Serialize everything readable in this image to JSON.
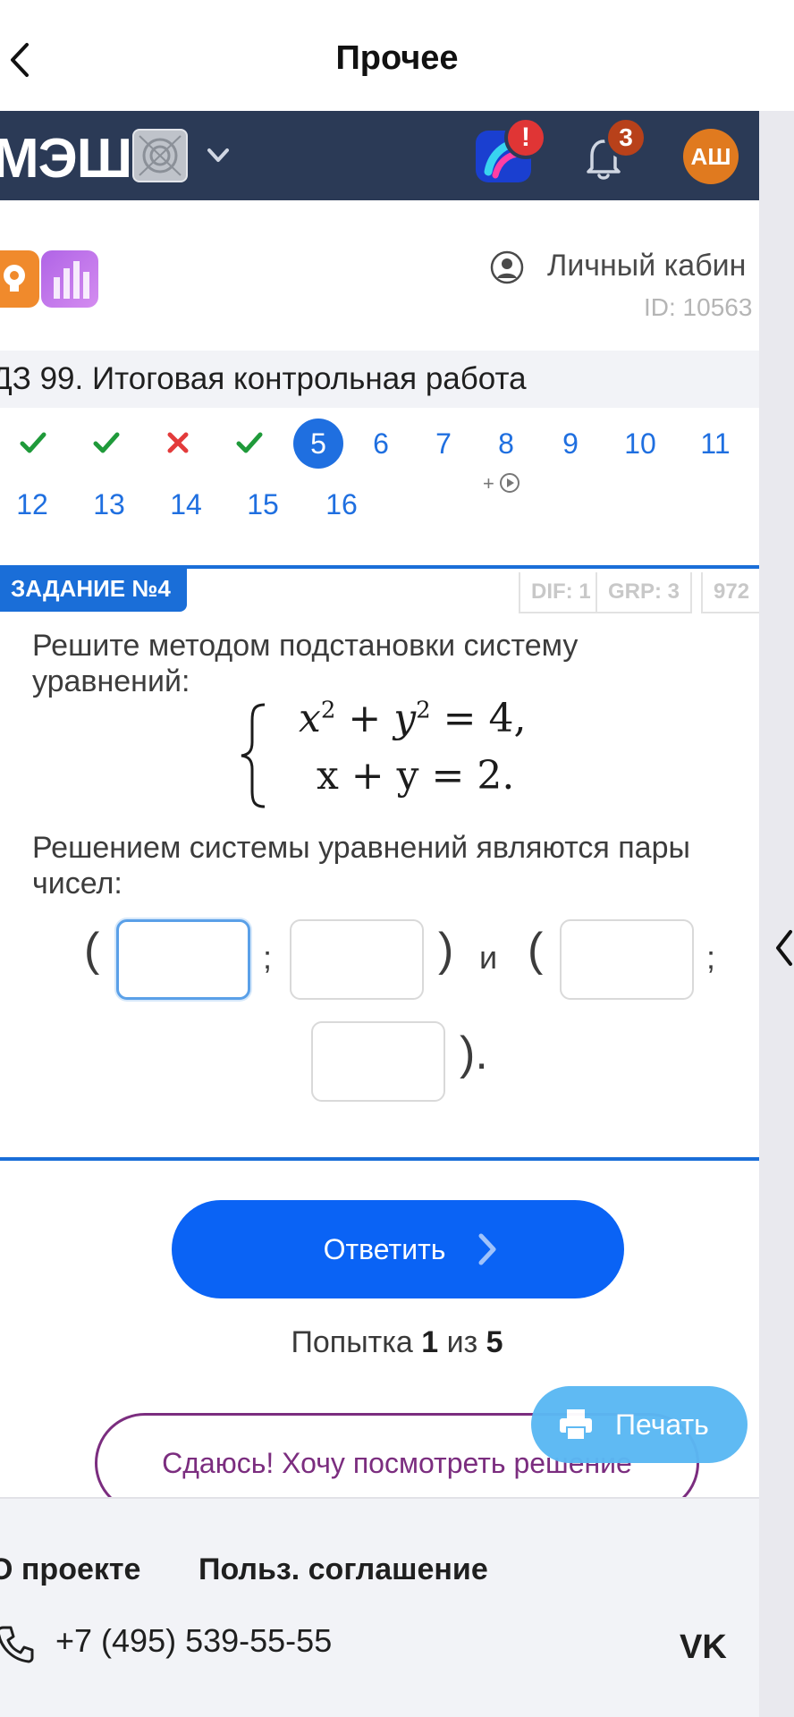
{
  "nav": {
    "title": "Прочее"
  },
  "topbar": {
    "logo": "МЭШ",
    "alert_badge": "!",
    "notifications_count": "3",
    "avatar_initials": "АШ"
  },
  "subheader": {
    "cabinet_label": "Личный кабин",
    "user_id": "ID: 10563"
  },
  "page": {
    "title": "ДЗ 99. Итоговая контрольная работа"
  },
  "task_nav": {
    "statuses": [
      "correct",
      "correct",
      "wrong",
      "correct"
    ],
    "current": "5",
    "numbers_row1": [
      "6",
      "7",
      "8",
      "9",
      "10",
      "11"
    ],
    "numbers_row2": [
      "12",
      "13",
      "14",
      "15",
      "16"
    ],
    "extra_label": "+"
  },
  "task": {
    "tag": "ЗАДАНИЕ №4",
    "meta": [
      "DIF: 1",
      "GRP: 3",
      "972"
    ],
    "prompt": "Решите методом подстановки систему уравнений:",
    "equation_1": {
      "x": "x",
      "y": "y",
      "exp": "2",
      "ops": "+",
      "eq": "= 4,"
    },
    "equation_2": "x + y = 2.",
    "answer_prompt": "Решением системы уравнений являются пары чисел:",
    "open_paren": "(",
    "close_paren": ")",
    "semicolon": ";",
    "and": "и",
    "closing": ")."
  },
  "actions": {
    "answer_label": "Ответить",
    "print_label": "Печать",
    "giveup_label": "Сдаюсь! Хочу посмотреть решение"
  },
  "attempt": {
    "prefix": "Попытка",
    "current": "1",
    "middle": "из",
    "total": "5"
  },
  "footer": {
    "about": "О проекте",
    "agreement": "Польз. соглашение",
    "phone": "+7 (495) 539-55-55"
  },
  "colors": {
    "accent": "#0a63f5",
    "topbar": "#2b3a56",
    "correct": "#1f9a3a",
    "wrong": "#e33b3b",
    "giveup": "#7b2d7f",
    "print": "#5ab8f3"
  }
}
